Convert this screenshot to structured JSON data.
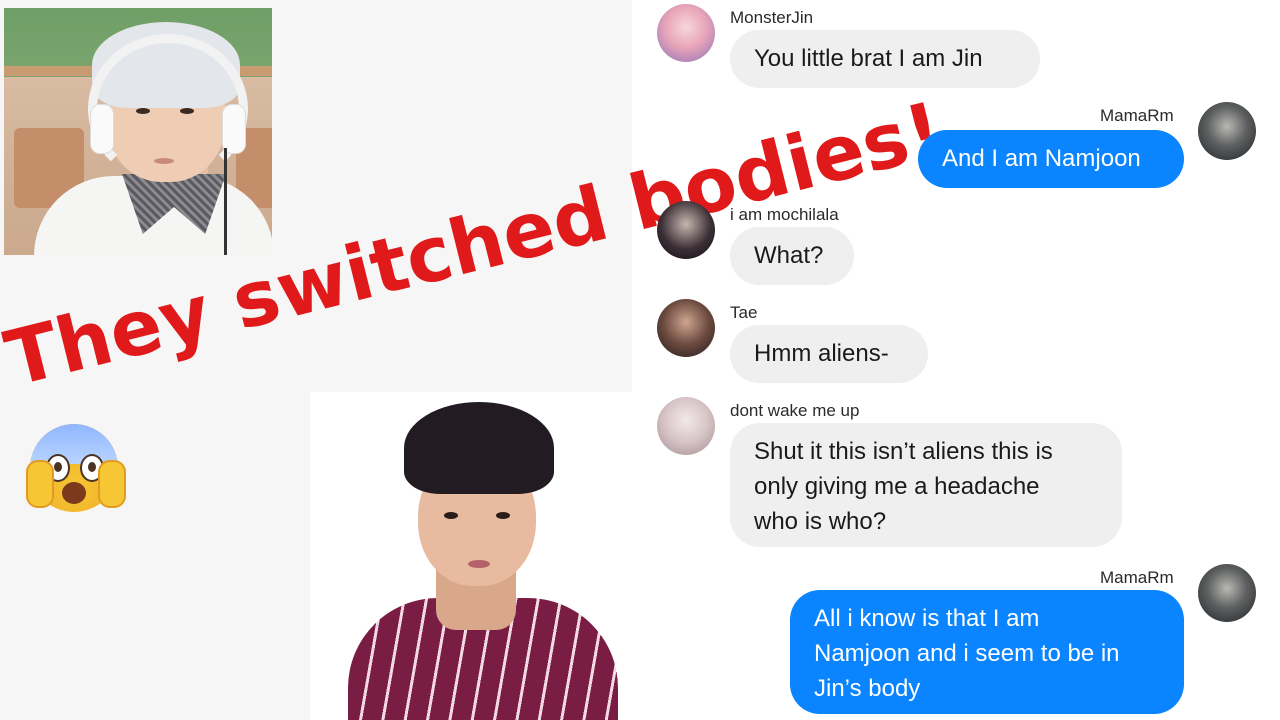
{
  "overlay": {
    "headline": "They switched bodies!",
    "emoji": "face-screaming-in-fear",
    "headline_color": "#e01a1a"
  },
  "colors": {
    "incoming_bubble": "#efefef",
    "outgoing_bubble": "#0a84ff"
  },
  "messages": [
    {
      "sender": "MonsterJin",
      "text_lines": [
        "You little brat I am Jin"
      ],
      "direction": "incoming"
    },
    {
      "sender": "MamaRm",
      "text_lines": [
        "And I am Namjoon"
      ],
      "direction": "outgoing"
    },
    {
      "sender": "i am mochilala",
      "text_lines": [
        "What?"
      ],
      "direction": "incoming"
    },
    {
      "sender": "Tae",
      "text_lines": [
        "Hmm aliens-"
      ],
      "direction": "incoming"
    },
    {
      "sender": "dont wake me up",
      "text_lines": [
        "Shut it this isn’t aliens this is",
        "only giving me a headache",
        "who is who?"
      ],
      "direction": "incoming"
    },
    {
      "sender": "MamaRm",
      "text_lines": [
        "All i know is that I am",
        "Namjoon and i seem to be in",
        "Jin’s body"
      ],
      "direction": "outgoing"
    }
  ]
}
